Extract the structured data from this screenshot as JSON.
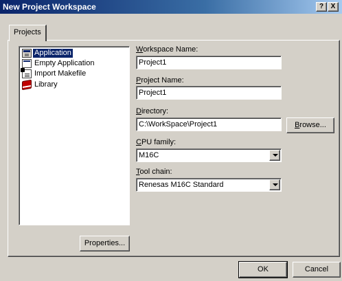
{
  "window": {
    "title": "New Project Workspace",
    "help_glyph": "?",
    "close_glyph": "X"
  },
  "tabs": [
    {
      "label": "Projects"
    }
  ],
  "project_types": [
    {
      "label": "Application",
      "icon": "application-icon",
      "selected": true
    },
    {
      "label": "Empty Application",
      "icon": "empty-application-icon",
      "selected": false
    },
    {
      "label": "Import Makefile",
      "icon": "import-makefile-icon",
      "selected": false
    },
    {
      "label": "Library",
      "icon": "library-icon",
      "selected": false
    }
  ],
  "form": {
    "workspace_name": {
      "label_key": "W",
      "label_rest": "orkspace Name:",
      "value": "Project1"
    },
    "project_name": {
      "label_key": "P",
      "label_rest": "roject Name:",
      "value": "Project1"
    },
    "directory": {
      "label_key": "D",
      "label_rest": "irectory:",
      "value": "C:\\WorkSpace\\Project1"
    },
    "cpu_family": {
      "label_key": "C",
      "label_rest": "PU family:",
      "value": "M16C"
    },
    "tool_chain": {
      "label_key": "T",
      "label_rest": "ool chain:",
      "value": "Renesas M16C Standard"
    }
  },
  "buttons": {
    "browse_key": "B",
    "browse_rest": "rowse...",
    "properties": "Properties...",
    "ok": "OK",
    "cancel": "Cancel"
  },
  "colors": {
    "title_gradient_start": "#0a246a",
    "face": "#d4d0c8",
    "selection": "#0a246a"
  }
}
